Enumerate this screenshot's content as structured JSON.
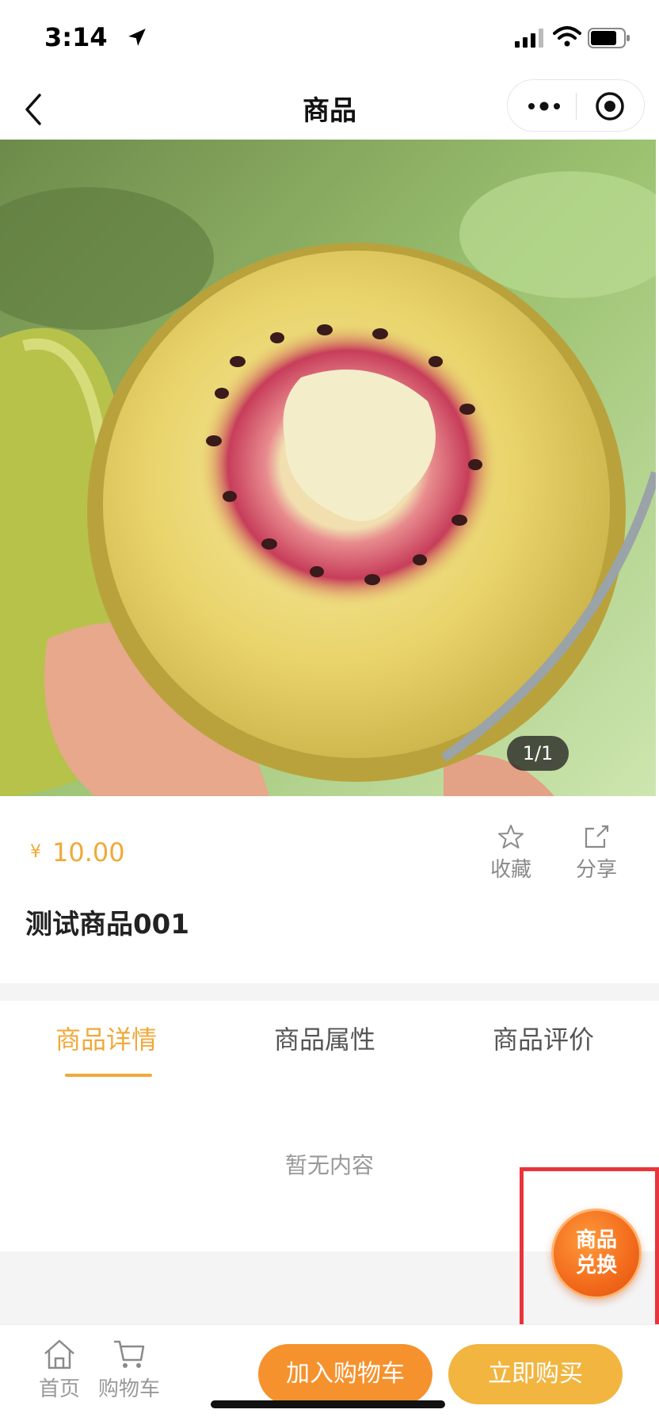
{
  "status_bar": {
    "time": "3:14",
    "icons": [
      "location-arrow-icon",
      "cellular-signal-icon",
      "wifi-icon",
      "battery-icon"
    ]
  },
  "nav": {
    "title": "商品",
    "icons": [
      "back-icon",
      "more-icon",
      "target-icon"
    ]
  },
  "gallery": {
    "counter": "1/1",
    "image_subject": "red-heart kiwi fruit cut in half"
  },
  "product": {
    "price_symbol": "¥",
    "price": "10.00",
    "name": "测试商品001",
    "favorite_label": "收藏",
    "share_label": "分享"
  },
  "tabs": {
    "items": [
      {
        "label": "商品详情",
        "active": true
      },
      {
        "label": "商品属性",
        "active": false
      },
      {
        "label": "商品评价",
        "active": false
      }
    ]
  },
  "content": {
    "empty_text": "暂无内容"
  },
  "exchange": {
    "line1": "商品",
    "line2": "兑换"
  },
  "bottom_bar": {
    "home_label": "首页",
    "cart_label": "购物车",
    "add_to_cart": "加入购物车",
    "buy_now": "立即购买"
  },
  "colors": {
    "accent": "#f0a93a",
    "cart_button": "#f5922e",
    "buy_button": "#f1b540",
    "highlight": "#e8343a",
    "exchange_orange": "#f26a1b"
  }
}
